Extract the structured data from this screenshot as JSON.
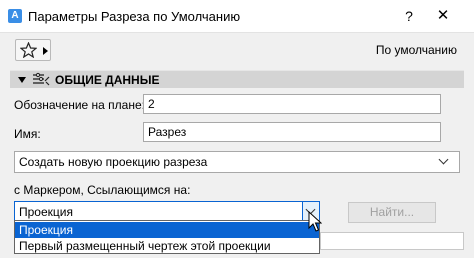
{
  "window": {
    "app_icon_glyph": "A",
    "title": "Параметры Разреза по Умолчанию",
    "help_glyph": "?",
    "close_glyph": "✕"
  },
  "toolbar": {
    "favorites_icon": "star-icon",
    "default_label": "По умолчанию"
  },
  "section": {
    "title": "ОБЩИЕ ДАННЫЕ"
  },
  "fields": {
    "plan_id_label": "Обозначение на плане:",
    "plan_id_value": "2",
    "name_label": "Имя:",
    "name_value": "Разрез"
  },
  "projection_mode": {
    "selected": "Создать новую проекцию разреза"
  },
  "marker": {
    "label": "с Маркером, Ссылающимся на:",
    "selected": "Проекция",
    "find_button": "Найти...",
    "options": [
      "Проекция",
      "Первый размещенный чертеж этой проекции"
    ]
  },
  "colors": {
    "accent": "#0a64d2",
    "section_bar": "#d4d4d4"
  }
}
